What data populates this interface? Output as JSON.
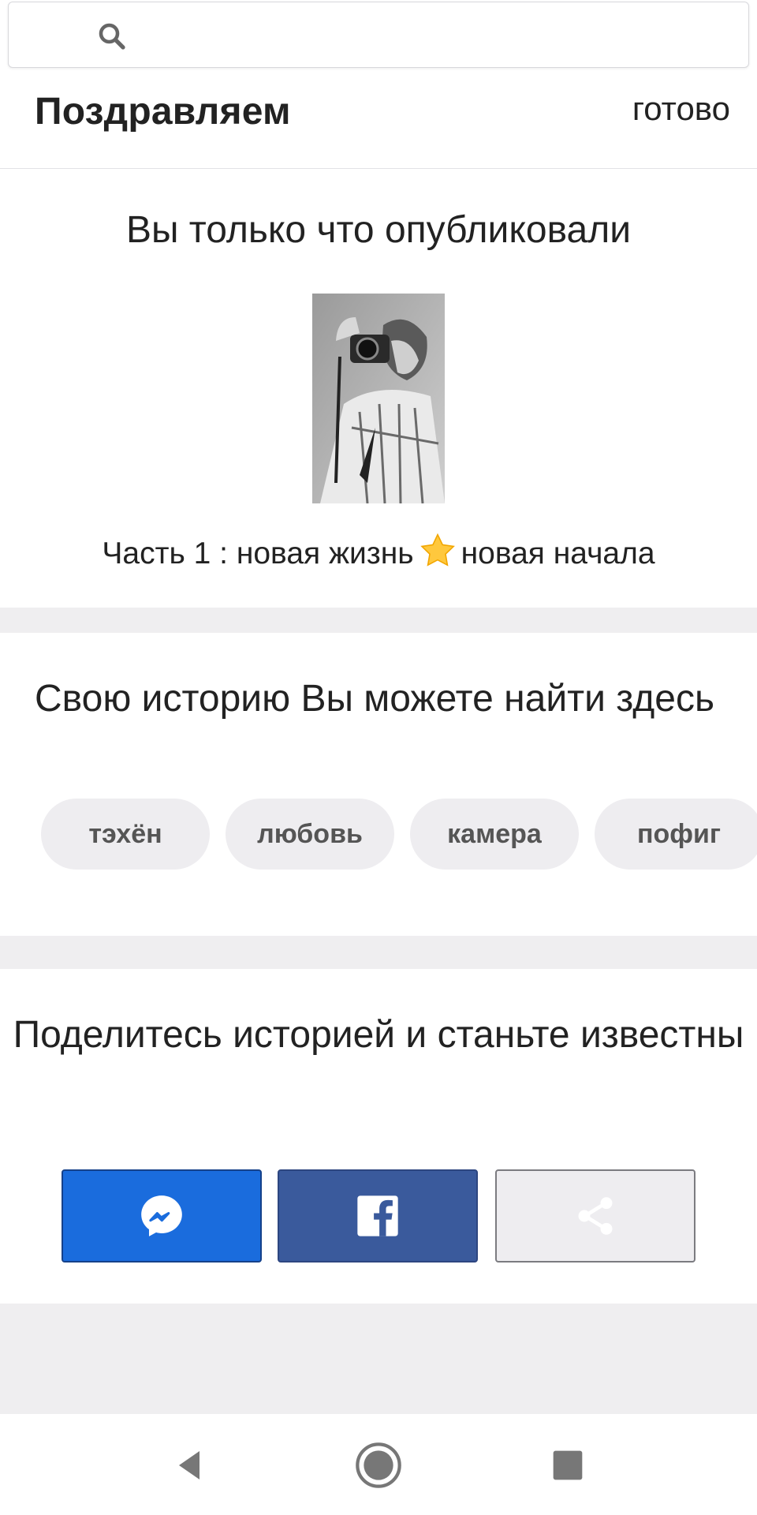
{
  "search": {
    "placeholder": "",
    "value": ""
  },
  "header": {
    "title": "Поздравляем",
    "done_label": "готово"
  },
  "published_card": {
    "heading": "Вы только что опубликовали",
    "story_part_prefix": "Часть 1 : новая жизнь",
    "story_part_suffix": "новая начала",
    "emoji_icon": "star-icon"
  },
  "tags_card": {
    "heading": "Свою историю Вы можете найти здесь",
    "tags": [
      "тэхён",
      "любовь",
      "камера",
      "пофиг"
    ]
  },
  "share_card": {
    "heading": "Поделитесь историей и станьте известны",
    "buttons": [
      {
        "icon": "messenger-icon",
        "color": "#1a6cdd"
      },
      {
        "icon": "facebook-icon",
        "color": "#3a5a9c"
      },
      {
        "icon": "share-icon",
        "color": "#eeedf0"
      }
    ]
  },
  "navigation": {
    "icons": [
      "back-icon",
      "home-icon",
      "recent-apps-icon"
    ]
  }
}
